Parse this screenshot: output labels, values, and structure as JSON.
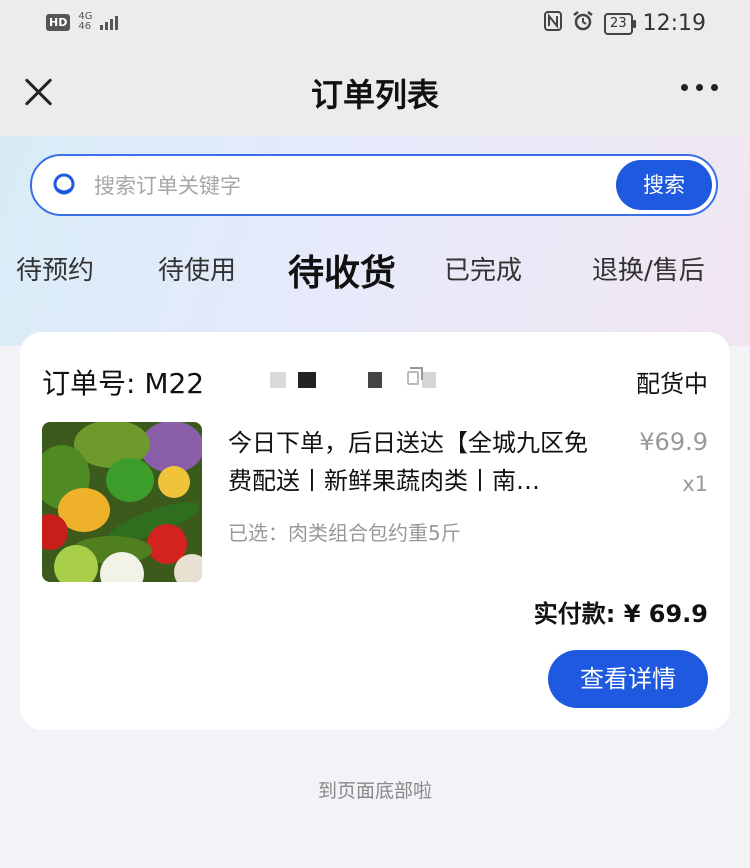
{
  "status_bar": {
    "hd": "HD",
    "network_top": "4G",
    "network_bottom": "46",
    "battery": "23",
    "time": "12:19"
  },
  "nav": {
    "title": "订单列表"
  },
  "search": {
    "placeholder": "搜索订单关键字",
    "button_label": "搜索"
  },
  "tabs": [
    {
      "label": "待预约"
    },
    {
      "label": "待使用"
    },
    {
      "label": "待收货",
      "active": true
    },
    {
      "label": "已完成"
    },
    {
      "label": "退换/售后"
    }
  ],
  "order": {
    "number_label": "订单号: M22",
    "status": "配货中",
    "product_title": "今日下单，后日送达【全城九区免费配送丨新鲜果蔬肉类丨南…",
    "price": "¥69.9",
    "quantity": "x1",
    "spec": "已选：肉类组合包约重5斤",
    "paid_amount": "实付款: ¥ 69.9",
    "detail_button": "查看详情"
  },
  "footer": {
    "text": "到页面底部啦"
  },
  "colors": {
    "accent": "#1e59e0",
    "muted": "#999999"
  }
}
